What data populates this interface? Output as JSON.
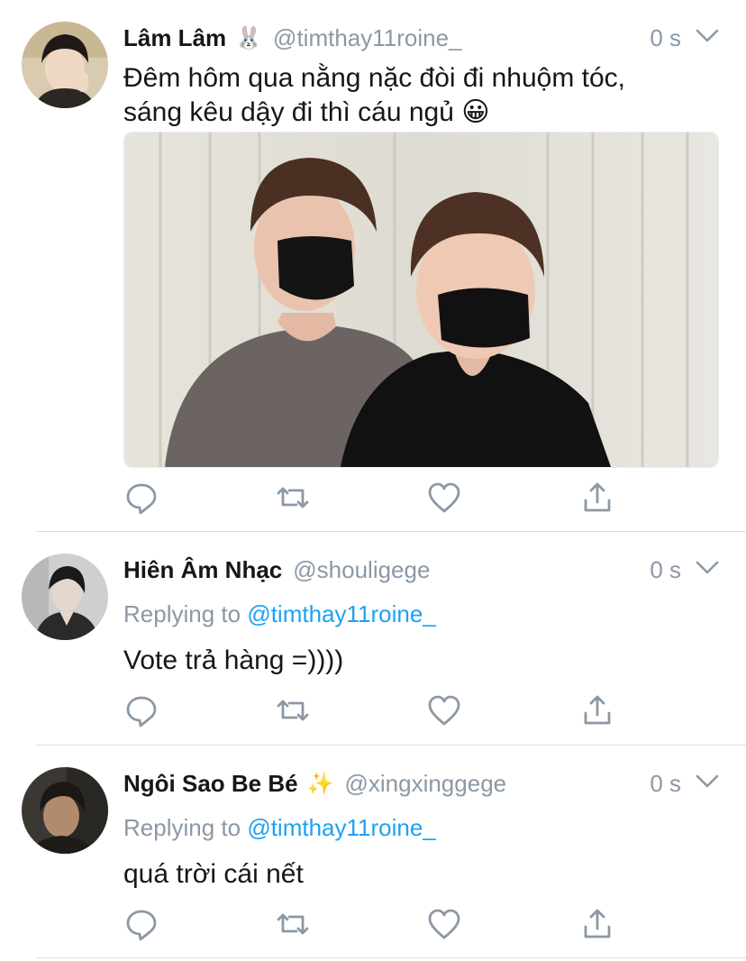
{
  "tweets": [
    {
      "name": "Lâm Lâm",
      "name_emoji": "🐰",
      "handle": "@timthay11roine_",
      "time": "0 s",
      "text_line1": "Đêm hôm qua nằng nặc đòi đi nhuộm tóc,",
      "text_line2": "sáng kêu dậy đi thì cáu ngủ 😀"
    },
    {
      "name": "Hiên Âm Nhạc",
      "handle": "@shouligege",
      "time": "0 s",
      "replying_prefix": "Replying to",
      "replying_to": "@timthay11roine_",
      "text": "Vote trả hàng =))))"
    },
    {
      "name": "Ngôi Sao Be Bé",
      "name_emoji": "✨",
      "handle": "@xingxinggege",
      "time": "0 s",
      "replying_prefix": "Replying to",
      "replying_to": "@timthay11roine_",
      "text": "quá trời cái nết"
    }
  ],
  "icons": {
    "reply": "reply-icon",
    "retweet": "retweet-icon",
    "like": "heart-icon",
    "share": "share-icon",
    "more": "chevron-down-icon"
  },
  "colors": {
    "link": "#1da1f2",
    "secondary_text": "#8b98a5",
    "icon": "#8b98a5",
    "divider": "#d8dde1"
  }
}
